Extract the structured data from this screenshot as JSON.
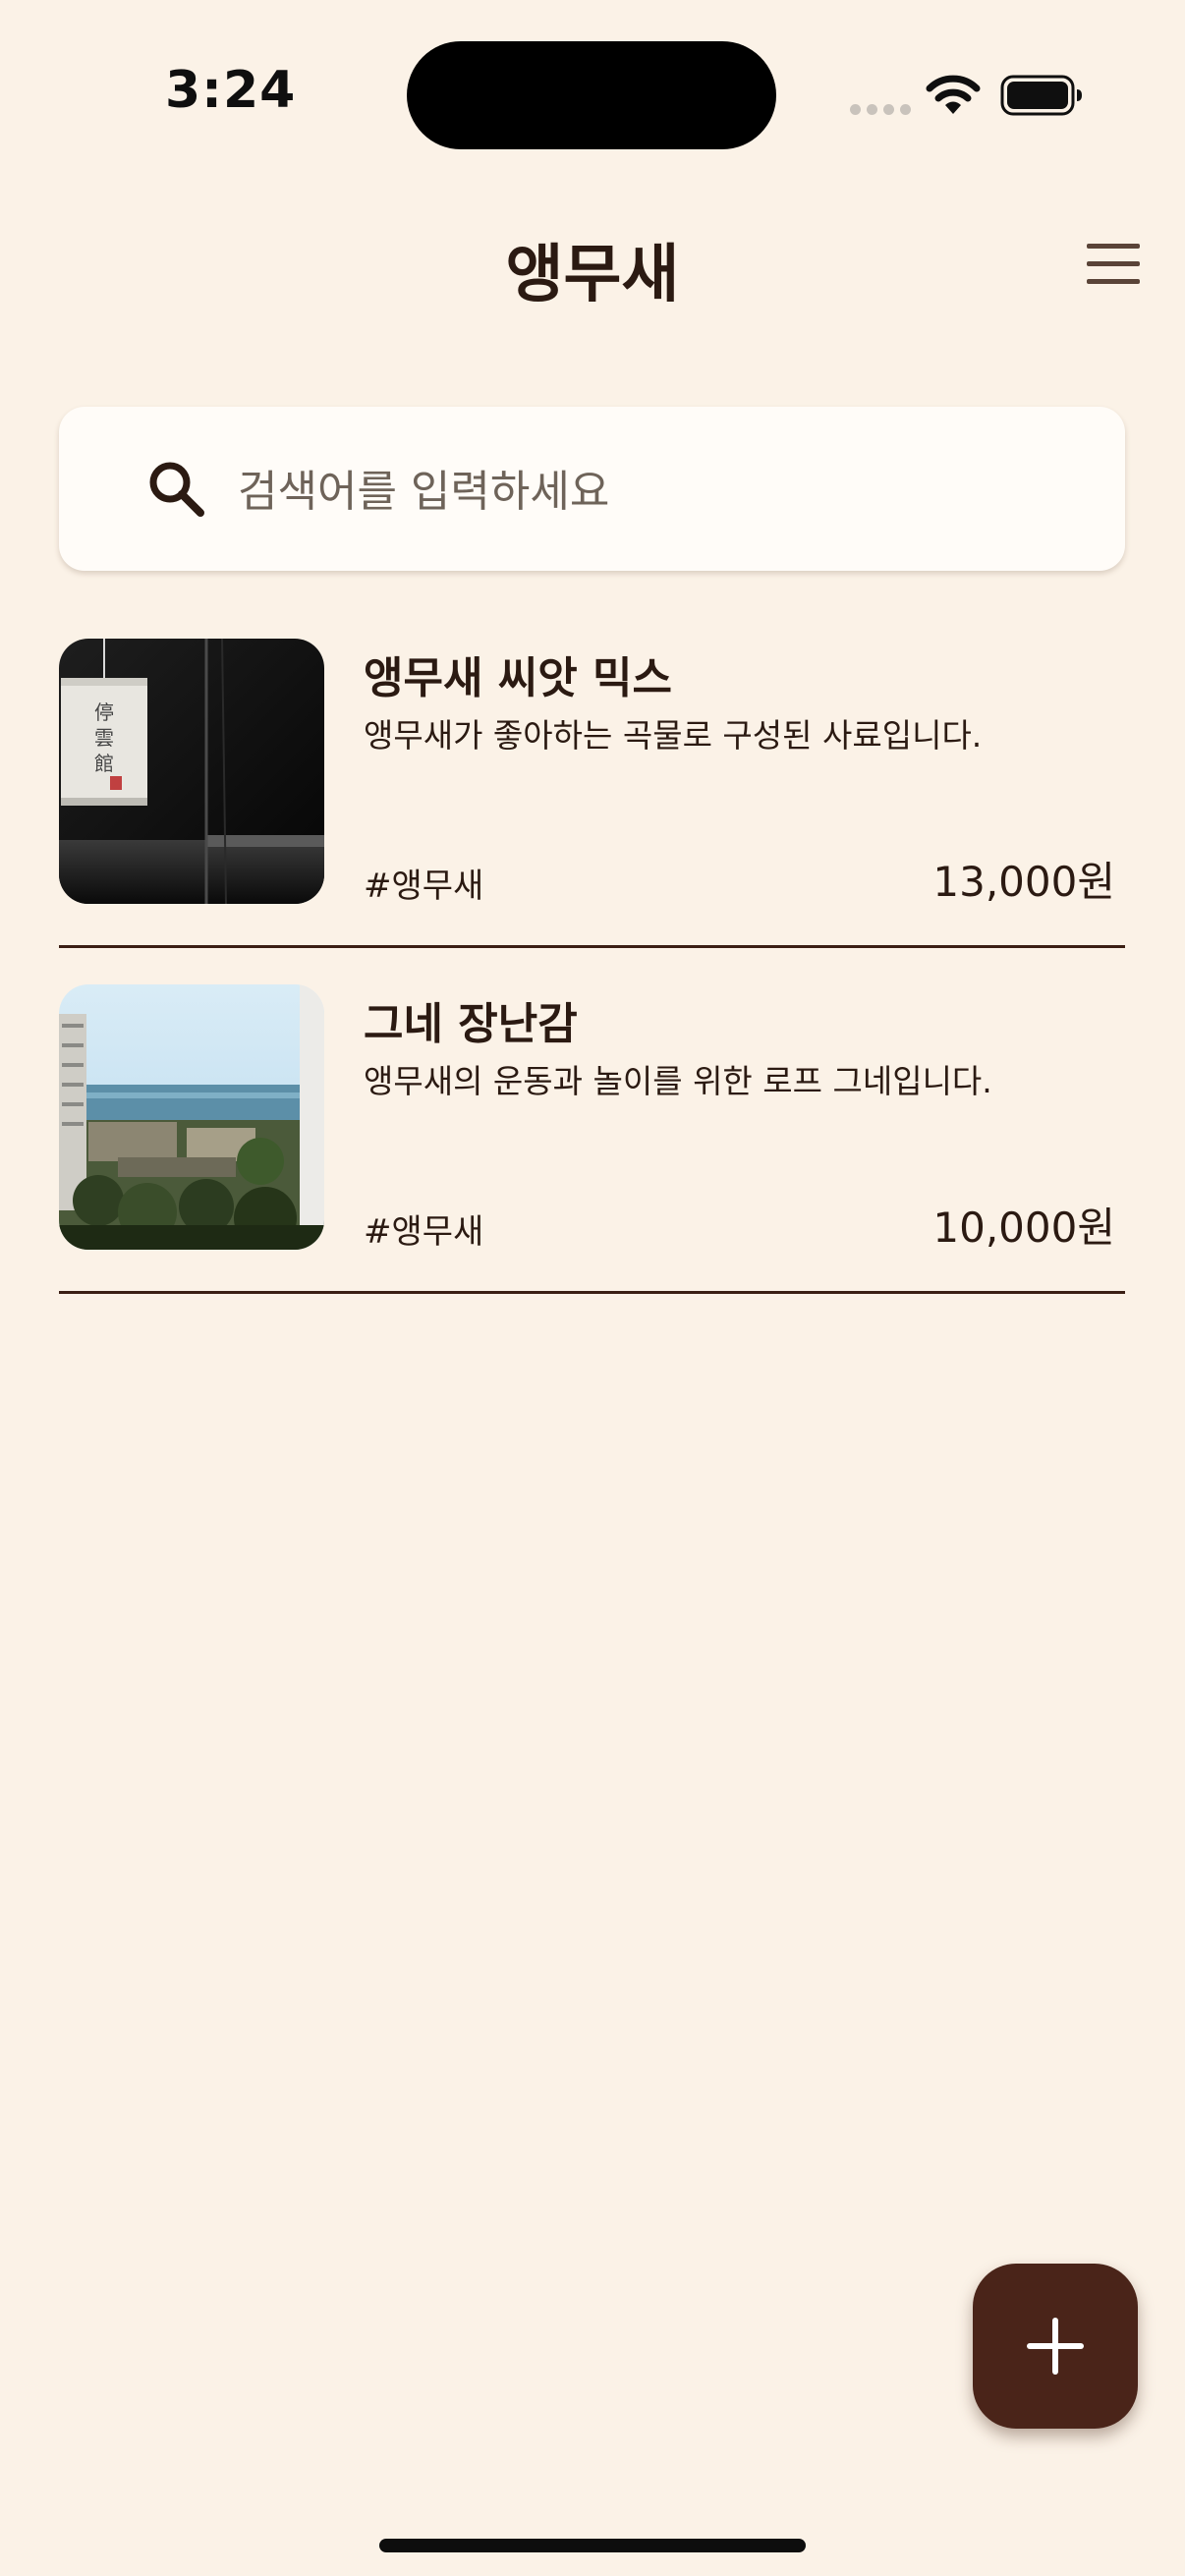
{
  "status_bar": {
    "time": "3:24"
  },
  "header": {
    "title": "앵무새",
    "menu_icon": "hamburger-menu-icon"
  },
  "search": {
    "placeholder": "검색어를 입력하세요",
    "value": "",
    "icon": "search-icon"
  },
  "products": [
    {
      "name": "앵무새 씨앗 믹스",
      "description": "앵무새가 좋아하는 곡물로 구성된 사료입니다.",
      "tag": "#앵무새",
      "price": "13,000원",
      "image": "paper-lantern-photo"
    },
    {
      "name": "그네 장난감",
      "description": "앵무새의 운동과 놀이를 위한 로프 그네입니다.",
      "tag": "#앵무새",
      "price": "10,000원",
      "image": "coastal-city-photo"
    }
  ],
  "fab": {
    "icon": "plus-icon"
  },
  "colors": {
    "background": "#fbf2e7",
    "primary_dark": "#4a2419",
    "text": "#2b1a12",
    "divider": "#3b1f14",
    "search_bg": "#fffcf8"
  }
}
